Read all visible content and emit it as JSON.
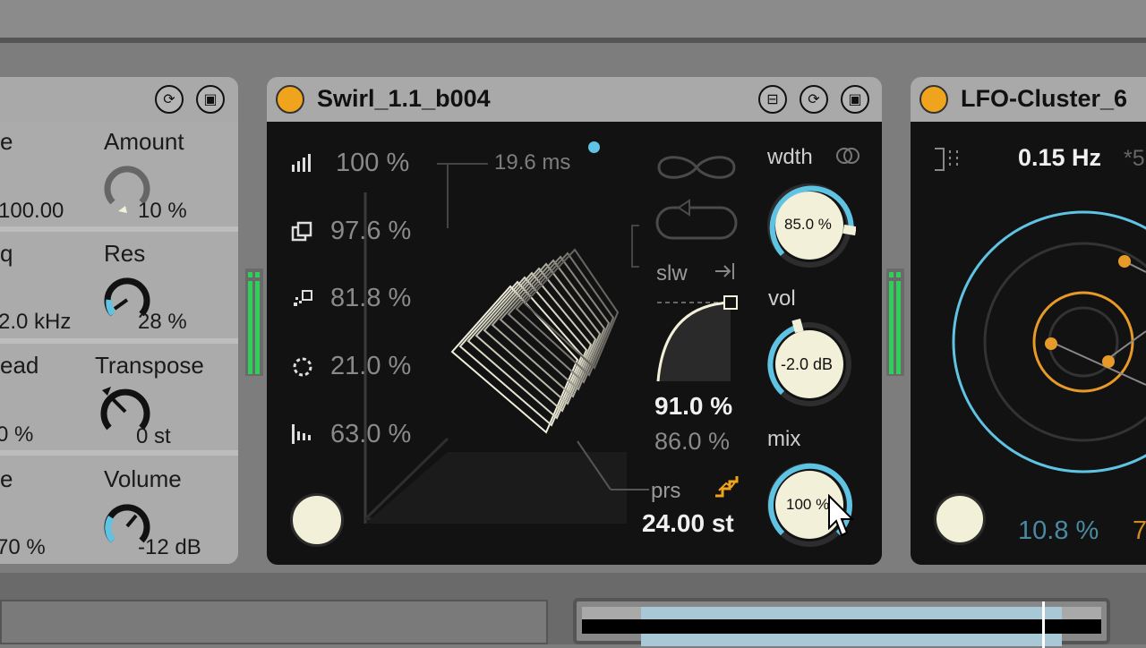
{
  "left_device": {
    "labels": {
      "amount": "Amount",
      "res": "Res",
      "transpose": "Transpose",
      "volume": "Volume",
      "frag_e1": "e",
      "frag_q": "q",
      "frag_ead": "ead",
      "frag_e2": "e"
    },
    "values": {
      "v1": "100.00",
      "amount": "10 %",
      "freq": "2.0 kHz",
      "res": "28 %",
      "spread": "0 %",
      "transpose": "0 st",
      "v4": "70 %",
      "volume": "-12 dB"
    }
  },
  "swirl": {
    "title": "Swirl_1.1_b004",
    "percents": [
      "100 %",
      "97.6 %",
      "81.8 %",
      "21.0 %",
      "63.0 %"
    ],
    "time": "19.6 ms",
    "slw": "slw",
    "val_bold": "91.0 %",
    "val_grey": "86.0 %",
    "prs": "prs",
    "st": "24.00 st",
    "wdth_label": "wdth",
    "wdth_value": "85.0 %",
    "vol_label": "vol",
    "vol_value": "-2.0 dB",
    "mix_label": "mix",
    "mix_value": "100 %"
  },
  "lfo": {
    "title": "LFO-Cluster_6",
    "rate": "0.15 Hz",
    "rate_extra": "*5",
    "v1": "10.8 %",
    "v2": "7"
  },
  "colors": {
    "accent": "#f0a41e",
    "blue": "#5fc3e4",
    "cream": "#f2f0d8",
    "panel": "#121212"
  },
  "icons": [
    "refresh-icon",
    "save-icon",
    "loop-icon",
    "infinity-icon",
    "undo-loop-icon",
    "step-icon"
  ]
}
